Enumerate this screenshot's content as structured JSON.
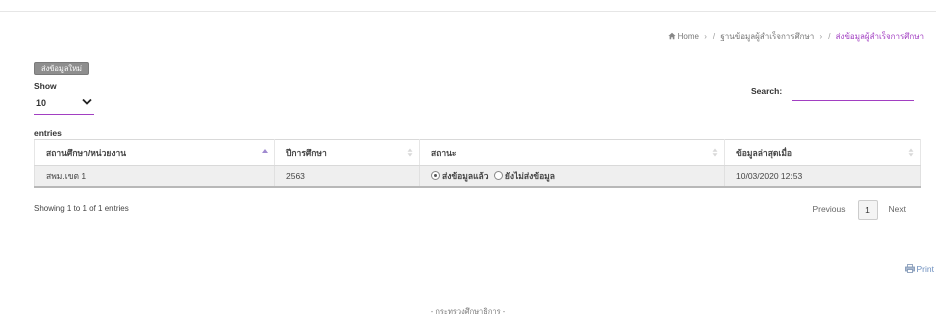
{
  "breadcrumb": {
    "home": "Home",
    "parent": "ฐานข้อมูลผู้สำเร็จการศึกษา",
    "current": "ส่งข้อมูลผู้สำเร็จการศึกษา",
    "separator": "/",
    "home_icon": "home-icon"
  },
  "new_button": {
    "label": "ส่งข้อมูลใหม่"
  },
  "length_control": {
    "show_label": "Show",
    "selected": "10",
    "entries_label": "entries"
  },
  "search": {
    "label": "Search:",
    "value": ""
  },
  "table": {
    "columns": [
      "สถานศึกษา/หน่วยงาน",
      "ปีการศึกษา",
      "สถานะ",
      "ข้อมูลล่าสุดเมื่อ"
    ],
    "rows": [
      {
        "org": "สพม.เขต 1",
        "year": "2563",
        "status_sent": "ส่งข้อมูลแล้ว",
        "status_not_sent": "ยังไม่ส่งข้อมูล",
        "updated": "10/03/2020 12:53"
      }
    ]
  },
  "info": "Showing 1 to 1 of 1 entries",
  "pagination": {
    "previous": "Previous",
    "current_page": "1",
    "next": "Next"
  },
  "print": {
    "label": "Print",
    "icon": "printer-icon"
  },
  "footer": "- กระทรวงศึกษาธิการ -",
  "colors": {
    "accent": "#a23fc2",
    "row_bg": "#efefef",
    "button_bg": "#8e8e8e",
    "print_link": "#6d8fbf"
  }
}
